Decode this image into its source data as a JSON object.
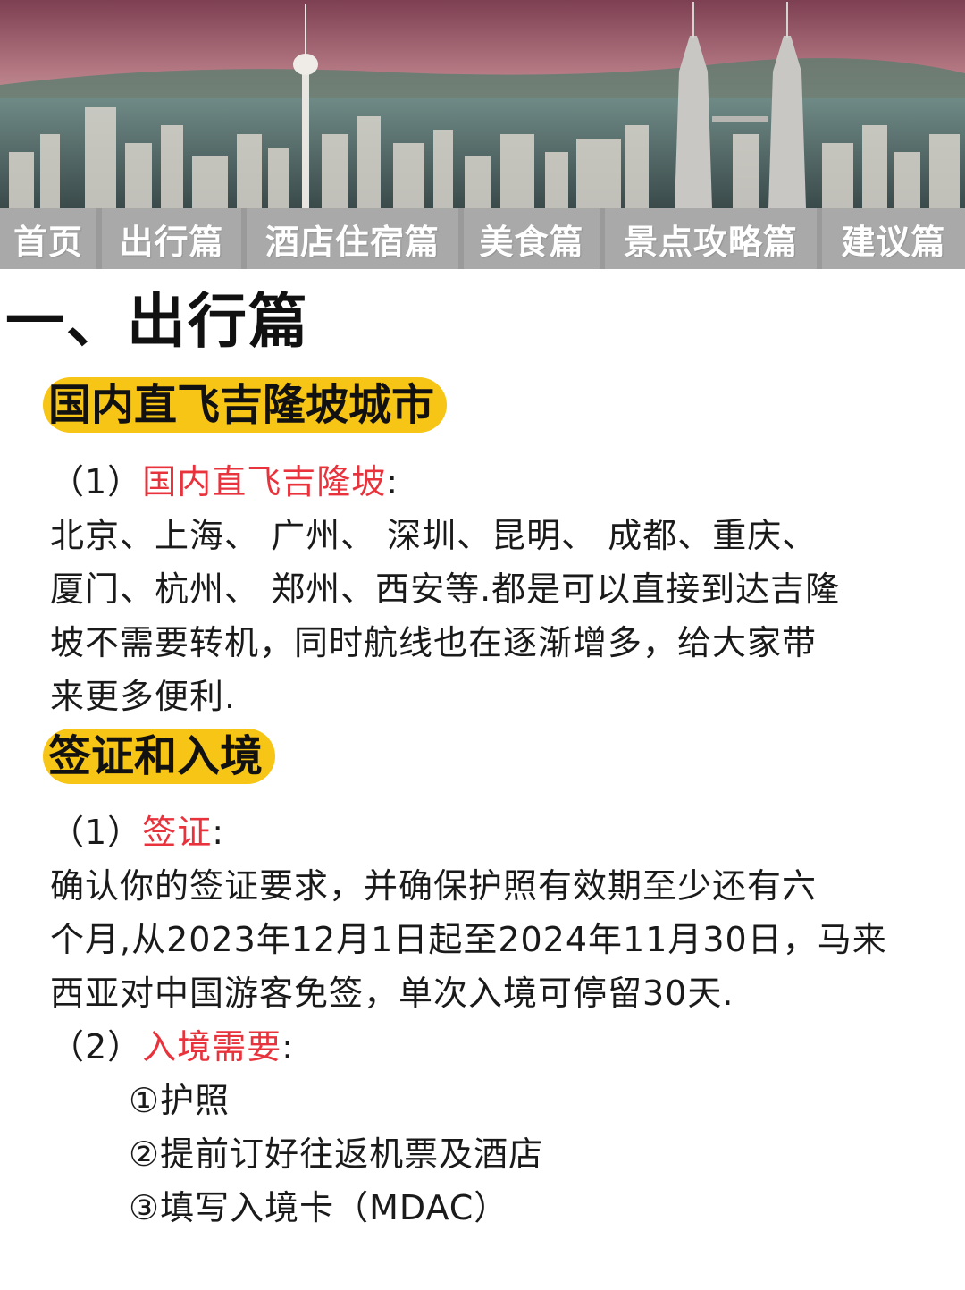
{
  "hero": {
    "image": "kuala-lumpur-skyline-photo"
  },
  "nav": {
    "tabs": [
      "首页",
      "出行篇",
      "酒店住宿篇",
      "美食篇",
      "景点攻略篇",
      "建议篇"
    ]
  },
  "section": {
    "title": "一、出行篇",
    "flights": {
      "heading": "国内直飞吉隆坡城市",
      "item1_prefix": "（1）",
      "item1_label": "国内直飞吉隆坡",
      "item1_colon": ":",
      "body_lines": [
        " 北京、上海、 广州、 深圳、昆明、 成都、重庆、",
        "厦门、杭州、 郑州、西安等.都是可以直接到达吉隆",
        "坡不需要转机，同时航线也在逐渐增多，给大家带",
        "来更多便利."
      ]
    },
    "visa": {
      "heading": "签证和入境",
      "item1_prefix": "（1）",
      "item1_label": "签证",
      "item1_colon": ":",
      "body_lines": [
        " 确认你的签证要求，并确保护照有效期至少还有六",
        "个月,从2023年12月1日起至2024年11月30日，马来",
        "西亚对中国游客免签，单次入境可停留30天."
      ],
      "item2_prefix": "（2）",
      "item2_label": "入境需要",
      "item2_colon": ":",
      "requirements": [
        "①护照",
        "②提前订好往返机票及酒店",
        "③填写入境卡（MDAC）"
      ]
    }
  },
  "colors": {
    "highlight": "#f7c515",
    "accent_red": "#e8333d",
    "nav_bg": "#a9a9a9"
  }
}
